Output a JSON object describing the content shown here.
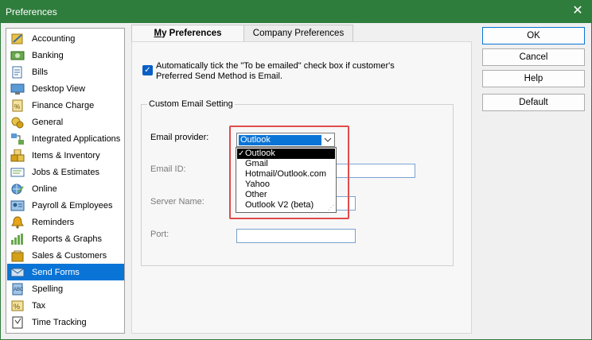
{
  "window": {
    "title": "Preferences"
  },
  "sidebar": {
    "items": [
      {
        "label": "Accounting",
        "icon": "accounting-icon"
      },
      {
        "label": "Banking",
        "icon": "banking-icon"
      },
      {
        "label": "Bills",
        "icon": "bills-icon"
      },
      {
        "label": "Desktop View",
        "icon": "desktop-view-icon"
      },
      {
        "label": "Finance Charge",
        "icon": "finance-charge-icon"
      },
      {
        "label": "General",
        "icon": "general-icon"
      },
      {
        "label": "Integrated Applications",
        "icon": "integrated-applications-icon"
      },
      {
        "label": "Items & Inventory",
        "icon": "items-inventory-icon"
      },
      {
        "label": "Jobs & Estimates",
        "icon": "jobs-estimates-icon"
      },
      {
        "label": "Online",
        "icon": "online-icon"
      },
      {
        "label": "Payroll & Employees",
        "icon": "payroll-employees-icon"
      },
      {
        "label": "Reminders",
        "icon": "reminders-icon"
      },
      {
        "label": "Reports & Graphs",
        "icon": "reports-graphs-icon"
      },
      {
        "label": "Sales & Customers",
        "icon": "sales-customers-icon"
      },
      {
        "label": "Send Forms",
        "icon": "send-forms-icon"
      },
      {
        "label": "Spelling",
        "icon": "spelling-icon"
      },
      {
        "label": "Tax",
        "icon": "tax-icon"
      },
      {
        "label": "Time Tracking",
        "icon": "time-tracking-icon"
      }
    ],
    "selected": "Send Forms"
  },
  "tabs": {
    "my_preferences_first": "M",
    "my_preferences_rest": "y Preferences",
    "company_preferences": "Company Preferences"
  },
  "settings": {
    "auto_tick_label": "Automatically tick the \"To be emailed\" check box if customer's Preferred Send Method is Email.",
    "auto_tick_checked": true,
    "group_title": "Custom Email Setting",
    "email_provider_label": "Email provider:",
    "email_provider_value": "Outlook",
    "email_id_label": "Email ID:",
    "server_name_label": "Server Name:",
    "port_label": "Port:"
  },
  "dropdown": {
    "options": [
      "Outlook",
      "Gmail",
      "Hotmail/Outlook.com",
      "Yahoo",
      "Other",
      "Outlook V2 (beta)"
    ],
    "selected": "Outlook"
  },
  "buttons": {
    "ok": "OK",
    "cancel": "Cancel",
    "help": "Help",
    "default": "Default"
  },
  "colors": {
    "titlebar": "#2f7d3c",
    "selection": "#0a74d6",
    "highlight_box": "#e04b4b"
  }
}
